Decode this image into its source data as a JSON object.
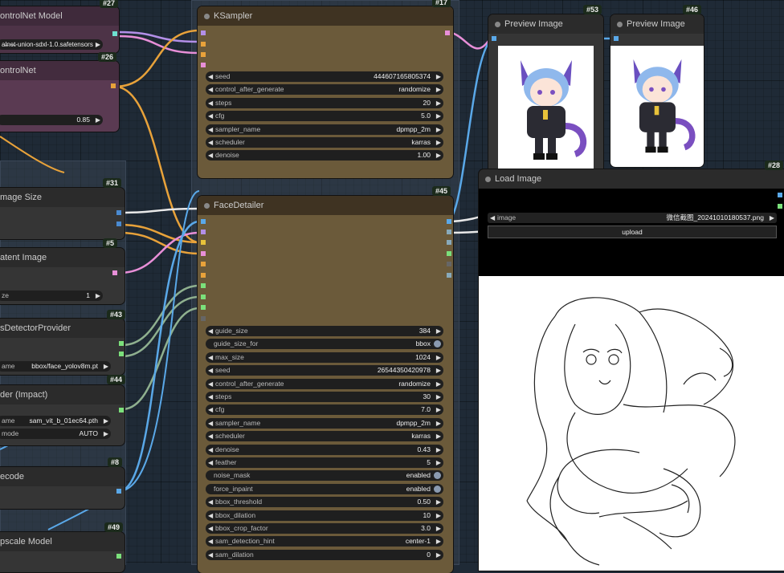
{
  "nodes": {
    "controlnet_model": {
      "title": "ontrolNet Model",
      "id": "#27",
      "value": "al̶ne̶t-union-sdxl-1.0.safetensors"
    },
    "controlnet": {
      "title": "ontrolNet",
      "id": "#26",
      "strength": "0.85"
    },
    "image_size": {
      "title": "mage Size",
      "id": "#31"
    },
    "latent_image": {
      "title": "atent Image",
      "id": "#5",
      "field_label": "ze",
      "field_value": "1"
    },
    "detector_provider": {
      "title": "sDetectorProvider",
      "id": "#43",
      "field_label": "ame",
      "field_value": "bbox/face_yolov8m.pt"
    },
    "sam_loader": {
      "title": "der (Impact)",
      "id": "#44",
      "rows": [
        {
          "label": "ame",
          "value": "sam_vit_b_01ec64.pth"
        },
        {
          "label": "mode",
          "value": "AUTO"
        }
      ]
    },
    "vae_decode": {
      "title": "ecode",
      "id": "#8"
    },
    "upscale_model": {
      "title": "pscale Model",
      "id": "#49"
    },
    "ksampler": {
      "title": "KSampler",
      "id": "#17",
      "widgets": [
        {
          "label": "seed",
          "value": "444607165805374"
        },
        {
          "label": "control_after_generate",
          "value": "randomize"
        },
        {
          "label": "steps",
          "value": "20"
        },
        {
          "label": "cfg",
          "value": "5.0"
        },
        {
          "label": "sampler_name",
          "value": "dpmpp_2m"
        },
        {
          "label": "scheduler",
          "value": "karras"
        },
        {
          "label": "denoise",
          "value": "1.00"
        }
      ]
    },
    "face_detailer": {
      "title": "FaceDetailer",
      "id": "#45",
      "widgets": [
        {
          "label": "guide_size",
          "value": "384",
          "kind": "num"
        },
        {
          "label": "guide_size_for",
          "value": "bbox",
          "kind": "toggle"
        },
        {
          "label": "max_size",
          "value": "1024",
          "kind": "num"
        },
        {
          "label": "seed",
          "value": "26544350420978",
          "kind": "num"
        },
        {
          "label": "control_after_generate",
          "value": "randomize",
          "kind": "num"
        },
        {
          "label": "steps",
          "value": "30",
          "kind": "num"
        },
        {
          "label": "cfg",
          "value": "7.0",
          "kind": "num"
        },
        {
          "label": "sampler_name",
          "value": "dpmpp_2m",
          "kind": "num"
        },
        {
          "label": "scheduler",
          "value": "karras",
          "kind": "num"
        },
        {
          "label": "denoise",
          "value": "0.43",
          "kind": "num"
        },
        {
          "label": "feather",
          "value": "5",
          "kind": "num"
        },
        {
          "label": "noise_mask",
          "value": "enabled",
          "kind": "toggle"
        },
        {
          "label": "force_inpaint",
          "value": "enabled",
          "kind": "toggle"
        },
        {
          "label": "bbox_threshold",
          "value": "0.50",
          "kind": "num"
        },
        {
          "label": "bbox_dilation",
          "value": "10",
          "kind": "num"
        },
        {
          "label": "bbox_crop_factor",
          "value": "3.0",
          "kind": "num"
        },
        {
          "label": "sam_detection_hint",
          "value": "center-1",
          "kind": "num"
        },
        {
          "label": "sam_dilation",
          "value": "0",
          "kind": "num"
        }
      ]
    },
    "preview1": {
      "title": "Preview Image",
      "id": "#53"
    },
    "preview2": {
      "title": "Preview Image",
      "id": "#46"
    },
    "load_image": {
      "title": "Load Image",
      "id": "#28",
      "image_label": "image",
      "image_value": "微信截图_20241010180537.png",
      "upload_label": "upload"
    }
  },
  "colors": {
    "canvas": "#1f2a36",
    "ksampler": "#6b5a3a",
    "controlnet": "#5a3a52",
    "wire_orange": "#e8a23a",
    "wire_purple": "#b38fe8",
    "wire_pink": "#e88fd8",
    "wire_blue": "#5aa8e8",
    "wire_green": "#8fb08f",
    "wire_white": "#e8e8e8"
  }
}
